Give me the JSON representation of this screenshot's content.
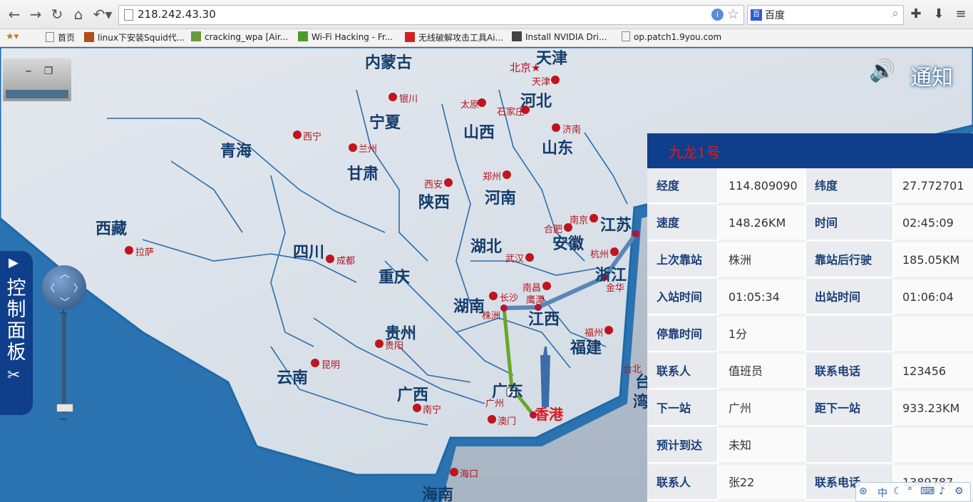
{
  "browser": {
    "url": "218.242.43.30",
    "search_engine": "百度"
  },
  "bookmarks": [
    {
      "label": "首页"
    },
    {
      "label": "linux下安装Squid代..."
    },
    {
      "label": "cracking_wpa [Air..."
    },
    {
      "label": "Wi-Fi Hacking - Fr..."
    },
    {
      "label": "无线破解攻击工具Ai..."
    },
    {
      "label": "Install NVIDIA Dri..."
    },
    {
      "label": "op.patch1.9you.com"
    }
  ],
  "map": {
    "provinces": [
      "内蒙古",
      "天津",
      "河北",
      "宁夏",
      "山西",
      "山东",
      "青海",
      "甘肃",
      "陕西",
      "河南",
      "江苏",
      "西藏",
      "四川",
      "湖北",
      "安徽",
      "重庆",
      "浙江",
      "湖南",
      "江西",
      "贵州",
      "福建",
      "云南",
      "广西",
      "广东",
      "台",
      "湾",
      "海南"
    ],
    "cities": [
      "北京★",
      "天津",
      "银川",
      "太原",
      "石家庄",
      "济南",
      "西宁",
      "兰州",
      "西安",
      "郑州",
      "南京",
      "合肥",
      "拉萨",
      "成都",
      "武汉",
      "杭州",
      "金华",
      "长沙",
      "南昌",
      "鹰潭",
      "株洲",
      "贵阳",
      "福州",
      "昆明",
      "台北",
      "广州",
      "南宁",
      "澳门",
      "海口"
    ],
    "highlight_city": "香港"
  },
  "control_panel": {
    "label": "控制面板"
  },
  "notice": {
    "label": "通知"
  },
  "info_panel": {
    "title": "九龙1号",
    "rows": [
      {
        "k1": "经度",
        "v1": "114.809090",
        "k2": "纬度",
        "v2": "27.772701"
      },
      {
        "k1": "速度",
        "v1": "148.26KM",
        "k2": "时间",
        "v2": "02:45:09"
      },
      {
        "k1": "上次靠站",
        "v1": "株洲",
        "k2": "靠站后行驶",
        "v2": "185.05KM"
      },
      {
        "k1": "入站时间",
        "v1": "01:05:34",
        "k2": "出站时间",
        "v2": "01:06:04"
      },
      {
        "k1": "停靠时间",
        "v1": "1分",
        "k2": "",
        "v2": ""
      },
      {
        "k1": "联系人",
        "v1": "值班员",
        "k2": "联系电话",
        "v2": "123456"
      },
      {
        "k1": "下一站",
        "v1": "广州",
        "k2": "距下一站",
        "v2": "933.23KM"
      },
      {
        "k1": "预计到达",
        "v1": "未知",
        "k2": "",
        "v2": ""
      },
      {
        "k1": "联系人",
        "v1": "张22",
        "k2": "联系电话",
        "v2": "1389787"
      }
    ]
  },
  "ime": {
    "label": "中"
  },
  "colors": {
    "panel_header": "#0f3e8a",
    "title_red": "#e21a1a",
    "city_red": "#b4141e",
    "route_blue": "#5b86b5",
    "route_green": "#6ba628"
  }
}
